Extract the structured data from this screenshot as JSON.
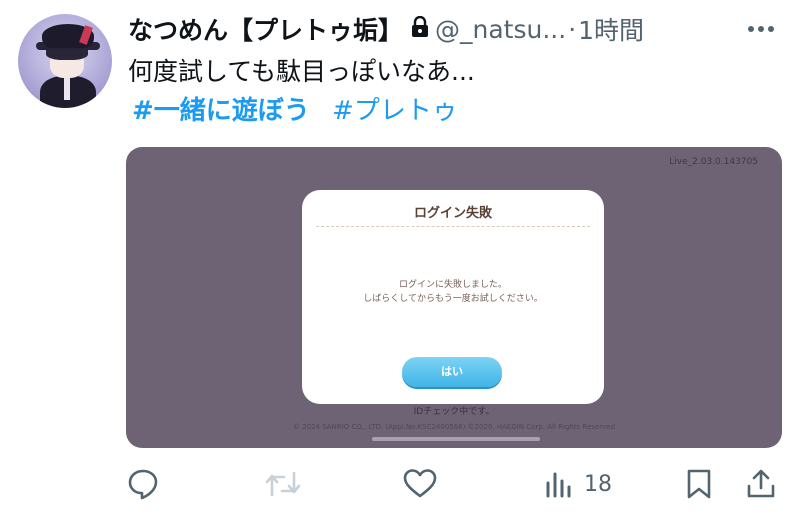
{
  "tweet": {
    "display_name": "なつめん【プレトゥ垢】",
    "handle": "@_natsu...",
    "separator": "·",
    "time": "1時間",
    "text": "何度試しても駄目っぽいなあ...",
    "hashtags": [
      "#一緒に遊ぼう",
      "#プレトゥ"
    ]
  },
  "media": {
    "version": "Live_2.03.0.143705",
    "dialog": {
      "title": "ログイン失敗",
      "message_line1": "ログインに失敗しました。",
      "message_line2": "しばらくしてからもう一度お試しください。",
      "button_label": "はい"
    },
    "id_check": "IDチェック中です。",
    "copyright": "© 2024 SANRIO CO., LTD. (Appl.No.KSC2400566)  ©2020. HAEGIN Corp. All Rights Reserved"
  },
  "actions": {
    "views_count": "18"
  },
  "icons": [
    "lock-icon",
    "more-icon",
    "reply-icon",
    "retweet-icon",
    "like-icon",
    "views-icon",
    "bookmark-icon",
    "share-icon"
  ],
  "colors": {
    "hashtag": "#1d9bf0",
    "secondary_text": "#536471",
    "media_background": "#6e6374",
    "dialog_button": "#3fb4e6"
  }
}
